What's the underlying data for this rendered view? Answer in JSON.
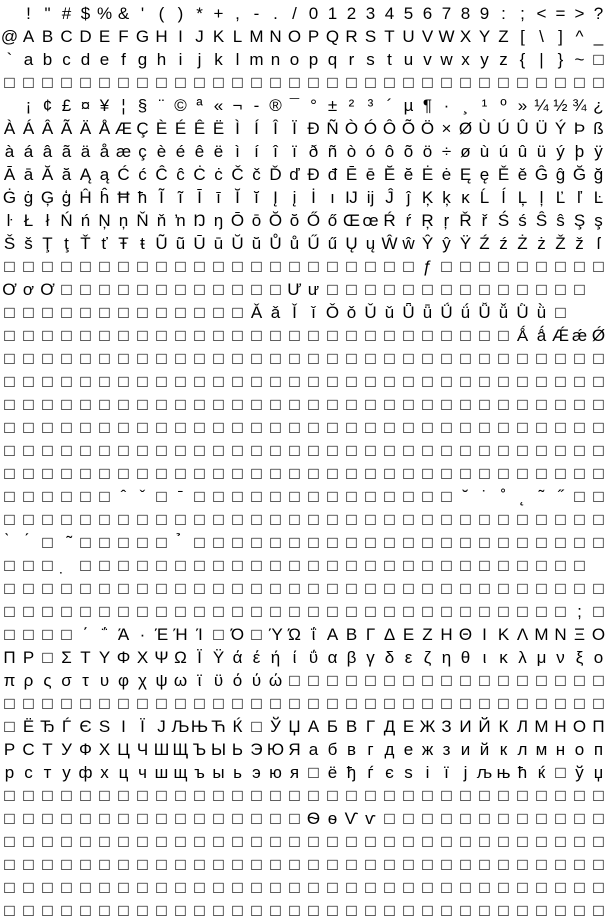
{
  "glyph_rows": [
    " !\"#$%&'()*+,-./0123456789:;<=>?",
    "@ABCDEFGHIJKLMNOPQRSTUVWXYZ[\\]^_",
    "`abcdefghijklmnopqrstuvwxyz{|}~□",
    "□□□□□□□□□□□□□□□□□□□□□□□□□□□□□□□□",
    " ¡¢£¤¥¦§¨©ª«¬-®¯°±²³´µ¶·¸¹º»¼½¾¿",
    "ÀÁÂÃÄÅÆÇÈÉÊËÌÍÎÏÐÑÒÓÔÕÖ×ØÙÚÛÜÝÞß",
    "àáâãäåæçèéêëìíîïðñòóôõö÷øùúûüýþÿ",
    "ĀāĂăĄąĆćĈĉĊċČčĎďĐđĒēĔĕĖėĘęĚěĜĝĞğ",
    "ĠġĢģĤĥĦħĨĩĪīĬĭĮįİıĲĳĴĵĶķĸĹĺĻļĽľĿ",
    "ŀŁłŃńŅņŇňŉŊŋŌōŎŏŐőŒœŔŕŖŗŘřŚśŜŝŞş",
    "ŠšŢţŤťŦŧŨũŪūŬŭŮůŰűŲųŴŵŶŷŸŹźŻżŽžſ",
    "□□□□□□□□□□□□□□□□□□□□□□ƒ□□□□□□□□□",
    "ƠơƠ□□□□□□□□□□□□Ưư□□□□□□□□□□□□□□",
    "□□□□□□□□□□□□□ǍǎǏǐǑǒǓǔǕǖǗǘǙǚǛǜ□",
    "□□□□□□□□□□□□□□□□□□□□□□□□□□□ǺǻǼǽǾǿ",
    "□□□□□□□□□□□□□□□□□□□□□□□□□□□□□□□□",
    "□□□□□□□□□□□□□□□□□□□□□□□□□□□□□□□□",
    "□□□□□□□□□□□□□□□□□□□□□□□□□□□□□□□□",
    "□□□□□□□□□□□□□□□□□□□□□□□□□□□□□□□□",
    "□□□□□□□□□□□□□□□□□□□□□□□□□□□□□□□□",
    "□□□□□□□□□□□□□□□□□□□□□□□□□□□□□□□□",
    "□□□□□□ˆˇ□ˉ□□□□□□□□□□□□□□˘˙˚˛˜˝□□",
    "□□□□□□□□□□□□□□□□□□□□□□□□□□□□□□□□",
    "̀́□̃□□□□□̉□□□□□□□□□□□□□□□□□□□□□□",
    "□□□̣□□□□□□□□□□□□□□□□□□□□□□□□□□□",
    "□□□□□□□□□□□□□□□□□□□□□□□□□□□□□□□□",
    "□□□□□□□□□□□□□□□□□□□□□□□□□□□□□□;□",
    "□□□□΄΅Ά·ΈΉΊ□Ό□ΎΏΐΑΒΓΔΕΖΗΘΙΚΛΜΝΞΟ",
    "ΠΡ□ΣΤΥΦΧΨΩΪΫάέήίΰαβγδεζηθικλμνξο",
    "πρςστυφχψωϊϋόύώ□□□□□□□□□□□□□□□□□",
    "□□□□□□□□□□□□□□□□□□□□□□□□□□□□□□□□",
    "□ЁЂЃЄЅІЇЈЉЊЋЌ□ЎЏАБВГДЕЖЗИЙКЛМНОП",
    "РСТУФХЦЧШЩЪЫЬЭЮЯабвгдежзийклмноп",
    "рстуфхцчшщъыьэюя□ёђѓєѕіїјљњћќ□ўџ",
    "□□□□□□□□□□□□□□□□□□□□□□□□□□□□□□□□",
    "□□□□□□□□□□□□□□□□ѲѳѴѵ□□□□□□□□□□□□",
    "□□□□□□□□□□□□□□□□□□□□□□□□□□□□□□□□",
    "□□□□□□□□□□□□□□□□□□□□□□□□□□□□□□□□",
    "□□□□□□□□□□□□□□□□□□□□□□□□□□□□□□□□",
    "□□□□□□□□□□□□□□□□□□□□□□□□□□□□□□□□"
  ]
}
